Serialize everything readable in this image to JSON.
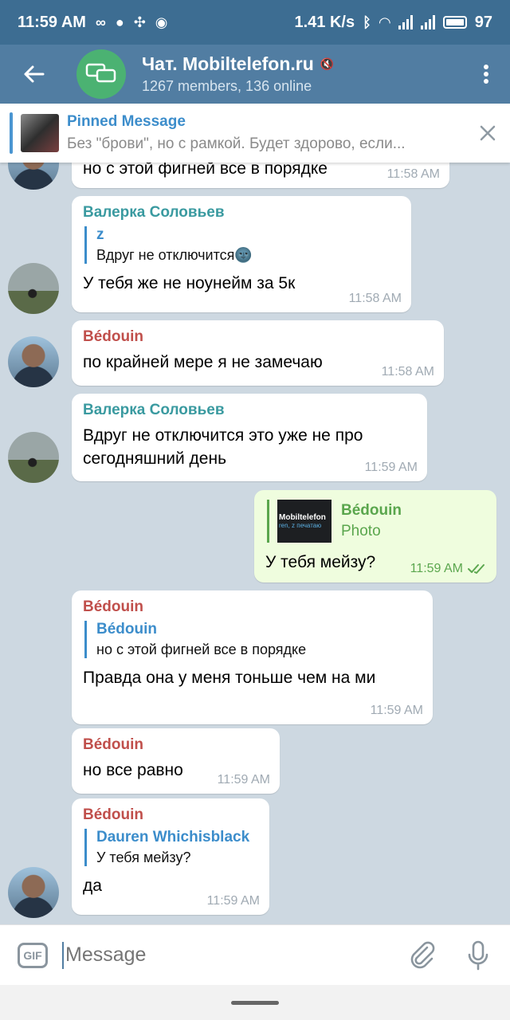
{
  "status": {
    "time": "11:59 AM",
    "speed": "1.41 K/s",
    "battery": "97"
  },
  "header": {
    "title": "Чат. Mobiltelefon.ru",
    "subtitle": "1267 members, 136 online",
    "back_icon": "arrow-left-icon",
    "menu_icon": "more-vertical-icon"
  },
  "pinned": {
    "title": "Pinned Message",
    "text": "Без \"брови\", но с рамкой. Будет здорово, если..."
  },
  "messages": [
    {
      "text": "но с этой фигней все в порядке",
      "time": "11:58 AM"
    },
    {
      "sender": "Валерка Соловьев",
      "reply_name": "z",
      "reply_text": "Вдруг не отключится🌚",
      "text": "У тебя же не ноунейм за 5к",
      "time": "11:58 AM"
    },
    {
      "sender": "Bédouin",
      "text": "по крайней мере я не замечаю",
      "time": "11:58 AM"
    },
    {
      "sender": "Валерка Соловьев",
      "text": "Вдруг не отключится это уже не про сегодняшний день",
      "time": "11:59 AM"
    },
    {
      "reply_name": "Bédouin",
      "reply_text": "Photo",
      "photo_text_1": "Mobiltelefon",
      "photo_text_2": "ren, z печатаю",
      "text": "У тебя мейзу?",
      "time": "11:59 AM"
    },
    {
      "sender": "Bédouin",
      "reply_name": "Bédouin",
      "reply_text": "но с этой фигней все в порядке",
      "text": "Правда она у меня тоньше чем на ми",
      "time": "11:59 AM"
    },
    {
      "sender": "Bédouin",
      "text": "но все равно",
      "time": "11:59 AM"
    },
    {
      "sender": "Bédouin",
      "reply_name": "Dauren Whichisblack",
      "reply_text": "У тебя мейзу?",
      "text": "да",
      "time": "11:59 AM"
    }
  ],
  "input": {
    "gif_label": "GIF",
    "placeholder": "Message"
  },
  "colors": {
    "header": "#517da2",
    "statusbar": "#3d6d92",
    "outgoing_bubble": "#effdde",
    "chat_bg": "#cdd8e1"
  }
}
